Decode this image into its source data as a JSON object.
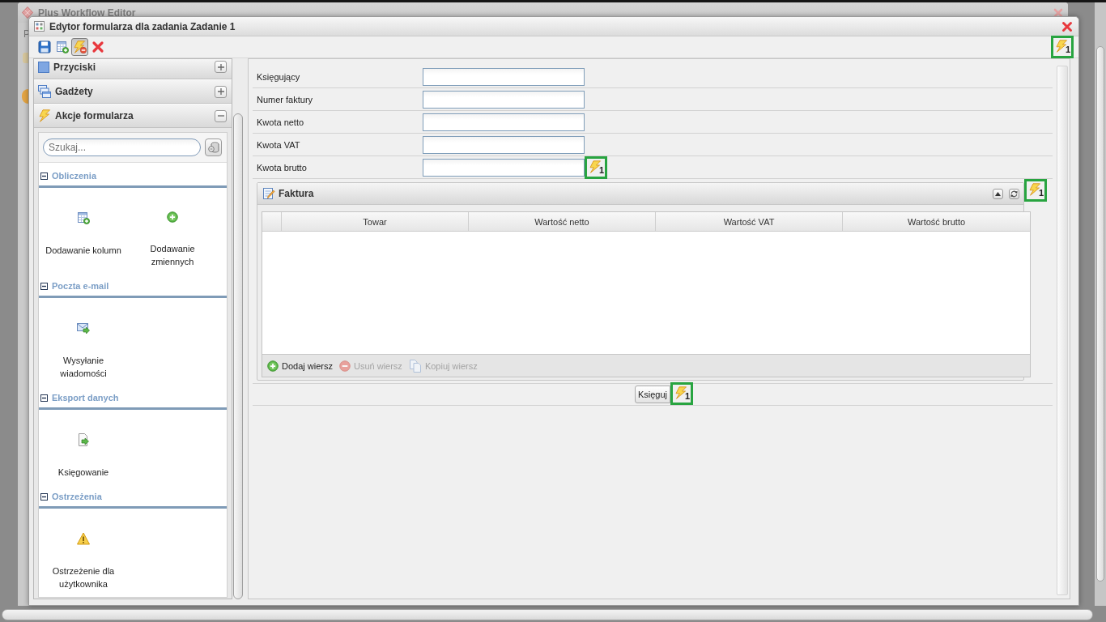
{
  "background_window": {
    "title": "Plus Workflow Editor",
    "menu": [
      "P"
    ]
  },
  "dialog": {
    "title": "Edytor formularza dla zadania Zadanie 1"
  },
  "toolbar": {
    "buttons": [
      {
        "kind": "save",
        "pressed": false
      },
      {
        "kind": "add_table",
        "pressed": false
      },
      {
        "kind": "actions",
        "pressed": true
      },
      {
        "kind": "delete",
        "pressed": false
      }
    ],
    "action_badge": "1"
  },
  "sidebar": {
    "sections": [
      {
        "title": "Przyciski",
        "kind": "buttons",
        "expanded": false
      },
      {
        "title": "Gadżety",
        "kind": "gadgets",
        "expanded": false
      },
      {
        "title": "Akcje formularza",
        "kind": "actions",
        "expanded": true
      }
    ],
    "search": {
      "placeholder": "Szukaj..."
    },
    "categories": [
      {
        "title": "Obliczenia",
        "expanded": true,
        "items": [
          {
            "label": "Dodawanie kolumn",
            "kind": "add_column"
          },
          {
            "label": "Dodawanie zmiennych",
            "kind": "add_variable"
          }
        ]
      },
      {
        "title": "Poczta e-mail",
        "expanded": true,
        "items": [
          {
            "label": "Wysyłanie wiadomości",
            "kind": "send_mail"
          }
        ]
      },
      {
        "title": "Eksport danych",
        "expanded": true,
        "items": [
          {
            "label": "Księgowanie",
            "kind": "export"
          }
        ]
      },
      {
        "title": "Ostrzeżenia",
        "expanded": true,
        "items": [
          {
            "label": "Ostrzeżenie dla użytkownika",
            "kind": "warning"
          }
        ]
      }
    ]
  },
  "form": {
    "fields": [
      {
        "label": "Księgujący"
      },
      {
        "label": "Numer faktury"
      },
      {
        "label": "Kwota netto"
      },
      {
        "label": "Kwota VAT"
      },
      {
        "label": "Kwota brutto",
        "action_badge": "1"
      }
    ],
    "table_panel": {
      "title": "Faktura",
      "action_badge": "1",
      "columns": [
        "Towar",
        "Wartość netto",
        "Wartość VAT",
        "Wartość brutto"
      ],
      "actions": [
        {
          "label": "Dodaj wiersz",
          "kind": "add",
          "disabled": false
        },
        {
          "label": "Usuń wiersz",
          "kind": "remove",
          "disabled": true
        },
        {
          "label": "Kopiuj wiersz",
          "kind": "copy",
          "disabled": true
        }
      ]
    },
    "submit": {
      "label": "Księguj",
      "action_badge": "1"
    }
  }
}
